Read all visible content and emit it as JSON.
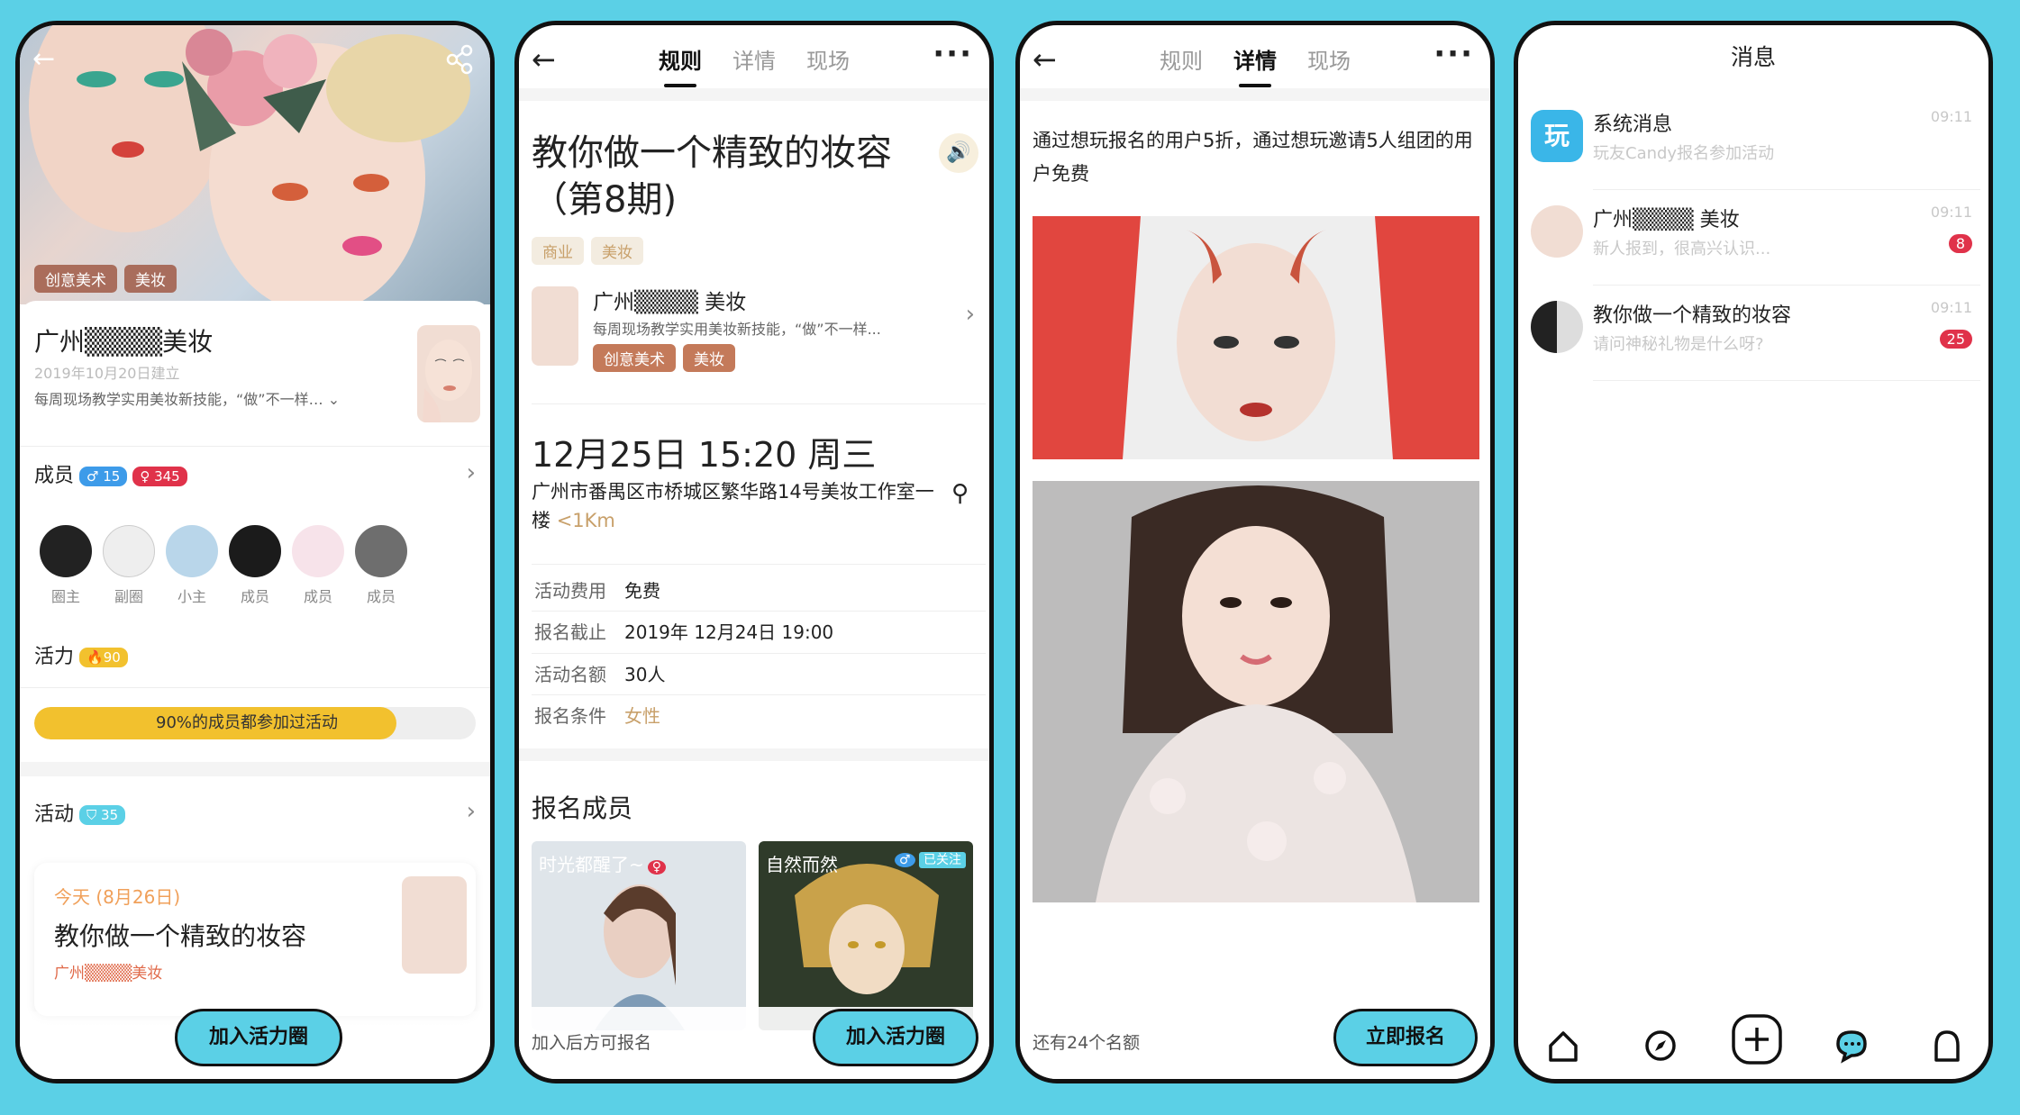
{
  "screen1": {
    "tags": [
      "创意美术",
      "美妆"
    ],
    "group_name": "广州▒▒▒▒美妆",
    "founded": "2019年10月20日建立",
    "desc": "每周现场教学实用美妆新技能，“做”不一样…",
    "members_label": "成员",
    "male_count": "♂ 15",
    "female_count": "♀ 345",
    "member_roles": [
      "圈主",
      "副圈",
      "小主",
      "成员",
      "成员",
      "成员"
    ],
    "vitality_label": "活力",
    "vitality_value": "🔥90",
    "vitality_progress": 0.82,
    "progress_text": "90%的成员都参加过活动",
    "activity_label": "活动",
    "activity_count": "35",
    "card_date": "今天 (8月26日)",
    "card_title": "教你做一个精致的妆容",
    "card_org": "广州▒▒▒▒美妆",
    "join_button": "加入活力圈"
  },
  "screen2": {
    "tabs": [
      "规则",
      "详情",
      "现场"
    ],
    "title": "教你做一个精致的妆容（第8期)",
    "tags": [
      "商业",
      "美妆"
    ],
    "org_name": "广州▒▒▒▒ 美妆",
    "org_desc": "每周现场教学实用美妆新技能，“做”不一样...",
    "org_tags": [
      "创意美术",
      "美妆"
    ],
    "datetime": "12月25日 15:20 周三",
    "address": "广州市番禺区市桥城区繁华路14号美妆工作室一楼",
    "distance": "<1Km",
    "rows": [
      {
        "k": "活动费用",
        "v": "免费"
      },
      {
        "k": "报名截止",
        "v": "2019年 12月24日 19:00"
      },
      {
        "k": "活动名额",
        "v": "30人"
      },
      {
        "k": "报名条件",
        "v": "女性"
      }
    ],
    "members_title": "报名成员",
    "member_cards": [
      {
        "name": "时光都醒了~",
        "gender": "♀"
      },
      {
        "name": "自然而然",
        "gender": "♂",
        "badge": "已关注"
      }
    ],
    "bottom_hint": "加入后方可报名",
    "join_button": "加入活力圈"
  },
  "screen3": {
    "tabs": [
      "规则",
      "详情",
      "现场"
    ],
    "promo": "通过想玩报名的用户5折，通过想玩邀请5人组团的用户免费",
    "remaining": "还有24个名额",
    "signup_button": "立即报名"
  },
  "screen4": {
    "title": "消息",
    "messages": [
      {
        "title": "系统消息",
        "sub": "玩友Candy报名参加活动",
        "time": "09:11",
        "badge": ""
      },
      {
        "title": "广州▒▒▒▒ 美妆",
        "sub": "新人报到，很高兴认识...",
        "time": "09:11",
        "badge": "8"
      },
      {
        "title": "教你做一个精致的妆容",
        "sub": "请问神秘礼物是什么呀?",
        "time": "09:11",
        "badge": "25"
      }
    ],
    "system_logo_text": "玩"
  },
  "colors": {
    "accent": "#5bd0e6",
    "progress": "#f2c12e",
    "badge": "#e0324a",
    "male": "#3d9be9",
    "female": "#e0324a",
    "gold": "#c8a06a"
  }
}
